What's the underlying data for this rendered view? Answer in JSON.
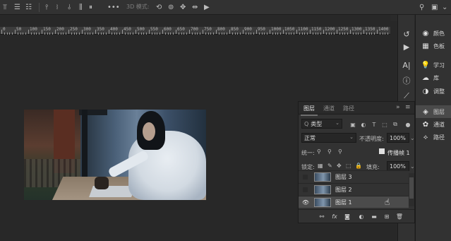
{
  "options_bar": {
    "mode_3d_label": "3D 模式:",
    "more_label": "•••",
    "search_icon": "search-icon",
    "workspace_icon": "workspace-icon",
    "chevron": "⌄"
  },
  "ruler": {
    "labels": [
      "0",
      "50",
      "100",
      "150",
      "200",
      "250",
      "300",
      "350",
      "400",
      "450",
      "500",
      "550",
      "600",
      "650",
      "700",
      "750",
      "800",
      "850",
      "900",
      "950",
      "1000",
      "1050",
      "1100",
      "1150",
      "1200",
      "1250",
      "1300",
      "1350",
      "1400"
    ]
  },
  "right_panel": {
    "items": [
      {
        "label": "颜色",
        "icon": "color-icon"
      },
      {
        "label": "色板",
        "icon": "swatches-icon"
      },
      {
        "label": "学习",
        "icon": "learn-icon"
      },
      {
        "label": "库",
        "icon": "libraries-icon"
      },
      {
        "label": "调整",
        "icon": "adjustments-icon"
      },
      {
        "label": "图层",
        "icon": "layers-icon"
      },
      {
        "label": "通道",
        "icon": "channels-icon"
      },
      {
        "label": "路径",
        "icon": "paths-icon"
      }
    ]
  },
  "layers_panel": {
    "tabs": [
      {
        "label": "图层",
        "active": true
      },
      {
        "label": "通道",
        "active": false
      },
      {
        "label": "路径",
        "active": false
      }
    ],
    "collapse_label": "»",
    "menu_label": "≡",
    "filter_label": "类型",
    "filter_prefix": "Q",
    "blend_mode": "正常",
    "opacity_label": "不透明度:",
    "opacity_value": "100%",
    "unify_label": "统一:",
    "propagate_label": "传播帧 1",
    "lock_label": "锁定:",
    "fill_label": "填充:",
    "fill_value": "100%",
    "layers": [
      {
        "name": "图层 3",
        "visible": false,
        "selected": false
      },
      {
        "name": "图层 2",
        "visible": false,
        "selected": false
      },
      {
        "name": "图层 1",
        "visible": true,
        "selected": true
      }
    ],
    "fx_label": "fx"
  }
}
